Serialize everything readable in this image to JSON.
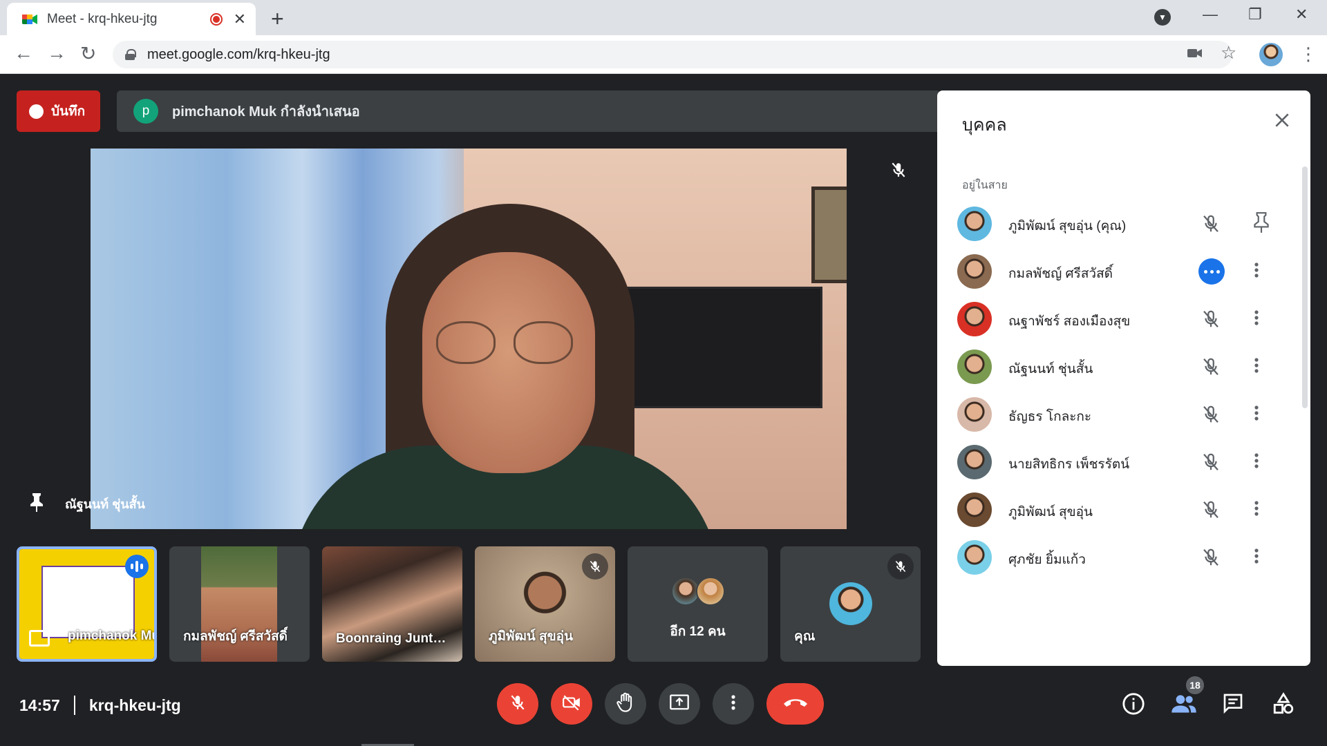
{
  "browser": {
    "tab_title": "Meet - krq-hkeu-jtg",
    "url": "meet.google.com/krq-hkeu-jtg"
  },
  "meeting": {
    "record_label": "บันทึก",
    "presenter_initial": "p",
    "presenting_text": "pimchanok Muk กำลังนำเสนอ",
    "pinned_name": "ณัฐนนท์ ชุ่นสั้น",
    "time": "14:57",
    "code": "krq-hkeu-jtg",
    "participant_count": "18"
  },
  "tiles": [
    {
      "label": "pimchanok Muk",
      "type": "presentation"
    },
    {
      "label": "กมลพัชญ์ ศรีสวัสดิ์",
      "type": "camera"
    },
    {
      "label": "Boonraing Junthong",
      "type": "camera"
    },
    {
      "label": "ภูมิพัฒน์ สุขอุ่น",
      "type": "camera",
      "muted": true
    },
    {
      "label": "อีก 12 คน",
      "type": "more"
    },
    {
      "label": "คุณ",
      "type": "self",
      "muted": true
    }
  ],
  "panel": {
    "title": "บุคคล",
    "section": "อยู่ในสาย",
    "people": [
      {
        "name": "ภูมิพัฒน์ สุขอุ่น (คุณ)",
        "state": "muted",
        "action": "pin",
        "avatar_color": "#5fb8e0"
      },
      {
        "name": "กมลพัชญ์ ศรีสวัสดิ์",
        "state": "speaking",
        "action": "more",
        "avatar_color": "#8a6a50"
      },
      {
        "name": "ณฐาพัชร์ สองเมืองสุข",
        "state": "muted",
        "action": "more",
        "avatar_color": "#d93025"
      },
      {
        "name": "ณัฐนนท์ ชุ่นสั้น",
        "state": "muted",
        "action": "more",
        "avatar_color": "#7a9a50"
      },
      {
        "name": "ธัญธร โกละกะ",
        "state": "muted",
        "action": "more",
        "avatar_color": "#d8b8a8"
      },
      {
        "name": "นายสิทธิกร เพ็ชรรัตน์",
        "state": "muted",
        "action": "more",
        "avatar_color": "#5a6a70"
      },
      {
        "name": "ภูมิพัฒน์ สุขอุ่น",
        "state": "muted",
        "action": "more",
        "avatar_color": "#6a4a30"
      },
      {
        "name": "ศุภชัย ยิ้มแก้ว",
        "state": "muted",
        "action": "more",
        "avatar_color": "#7ad0e8"
      }
    ]
  },
  "colors": {
    "accent": "#1a73e8",
    "danger": "#ea4335",
    "background": "#202124",
    "surface": "#3c4043"
  }
}
